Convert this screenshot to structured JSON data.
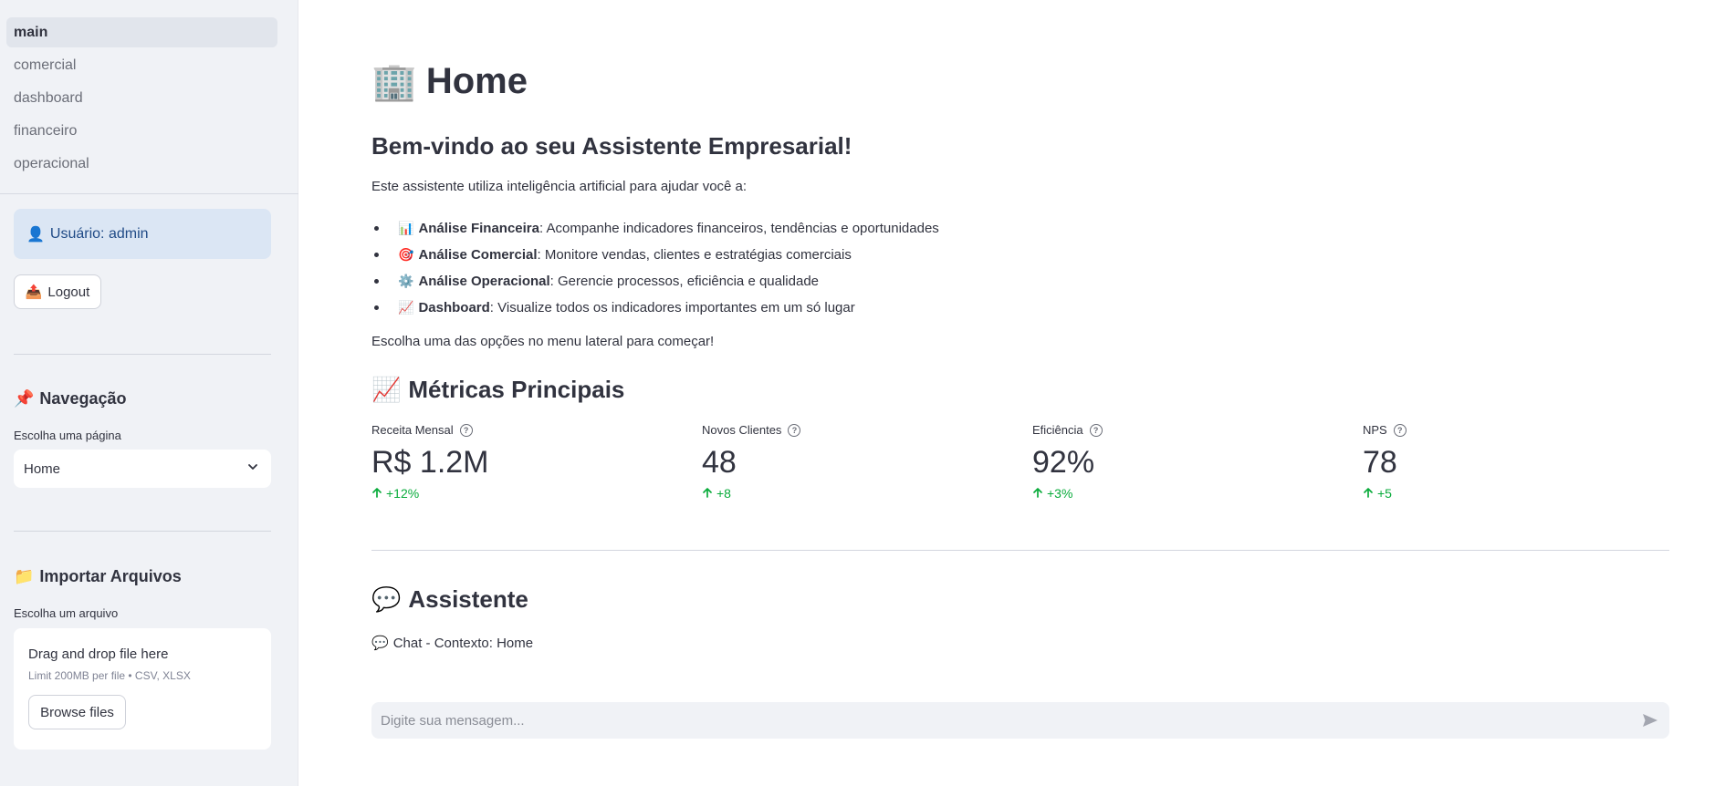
{
  "sidebar": {
    "pages": [
      {
        "label": "main",
        "active": true
      },
      {
        "label": "comercial",
        "active": false
      },
      {
        "label": "dashboard",
        "active": false
      },
      {
        "label": "financeiro",
        "active": false
      },
      {
        "label": "operacional",
        "active": false
      }
    ],
    "user_icon": "👤",
    "user_text": "Usuário: admin",
    "logout_icon": "📤",
    "logout_label": "Logout",
    "nav_icon": "📌",
    "nav_title": "Navegação",
    "nav_select_label": "Escolha uma página",
    "nav_select_value": "Home",
    "import_icon": "📁",
    "import_title": "Importar Arquivos",
    "file_label": "Escolha um arquivo",
    "drop_text": "Drag and drop file here",
    "drop_limit": "Limit 200MB per file • CSV, XLSX",
    "browse_label": "Browse files"
  },
  "main": {
    "title_icon": "🏢",
    "title": "Home",
    "welcome": "Bem-vindo ao seu Assistente Empresarial!",
    "intro": "Este assistente utiliza inteligência artificial para ajudar você a:",
    "features": [
      {
        "icon": "📊",
        "bold": "Análise Financeira",
        "text": ": Acompanhe indicadores financeiros, tendências e oportunidades"
      },
      {
        "icon": "🎯",
        "bold": "Análise Comercial",
        "text": ": Monitore vendas, clientes e estratégias comerciais"
      },
      {
        "icon": "⚙️",
        "bold": "Análise Operacional",
        "text": ": Gerencie processos, eficiência e qualidade"
      },
      {
        "icon": "📈",
        "bold": "Dashboard",
        "text": ": Visualize todos os indicadores importantes em um só lugar"
      }
    ],
    "choose": "Escolha uma das opções no menu lateral para começar!",
    "metrics_icon": "📈",
    "metrics_title": "Métricas Principais",
    "metrics": [
      {
        "label": "Receita Mensal",
        "value": "R$ 1.2M",
        "delta": "+12%"
      },
      {
        "label": "Novos Clientes",
        "value": "48",
        "delta": "+8"
      },
      {
        "label": "Eficiência",
        "value": "92%",
        "delta": "+3%"
      },
      {
        "label": "NPS",
        "value": "78",
        "delta": "+5"
      }
    ],
    "help_glyph": "?",
    "assistant_icon": "💬",
    "assistant_title": "Assistente",
    "chat_context_icon": "💬",
    "chat_context": "Chat - Contexto: Home",
    "chat_placeholder": "Digite sua mensagem..."
  },
  "colors": {
    "sidebar_bg": "#f0f2f6",
    "delta_positive": "#09ab3b",
    "user_box_bg": "#dbe6f4",
    "user_box_text": "#1f4a86"
  },
  "icons": [
    "user-icon",
    "outbox-icon",
    "pushpin-icon",
    "folder-icon",
    "chevron-down-icon",
    "office-icon",
    "bar-chart-icon",
    "target-icon",
    "gear-icon",
    "chart-up-icon",
    "help-icon",
    "arrow-up-icon",
    "speech-bubble-icon",
    "send-icon"
  ]
}
